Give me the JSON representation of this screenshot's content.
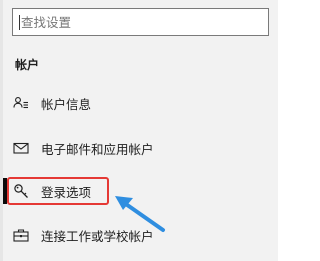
{
  "search": {
    "placeholder": "查找设置",
    "value": ""
  },
  "section": {
    "title": "帐户"
  },
  "nav": {
    "items": [
      {
        "label": "帐户信息",
        "icon": "person-list-icon",
        "selected": false
      },
      {
        "label": "电子邮件和应用帐户",
        "icon": "mail-icon",
        "selected": false
      },
      {
        "label": "登录选项",
        "icon": "key-icon",
        "selected": true
      },
      {
        "label": "连接工作或学校帐户",
        "icon": "briefcase-icon",
        "selected": false
      }
    ]
  },
  "annotation": {
    "highlight_color": "#e53935",
    "arrow_color": "#2f8ee0"
  }
}
